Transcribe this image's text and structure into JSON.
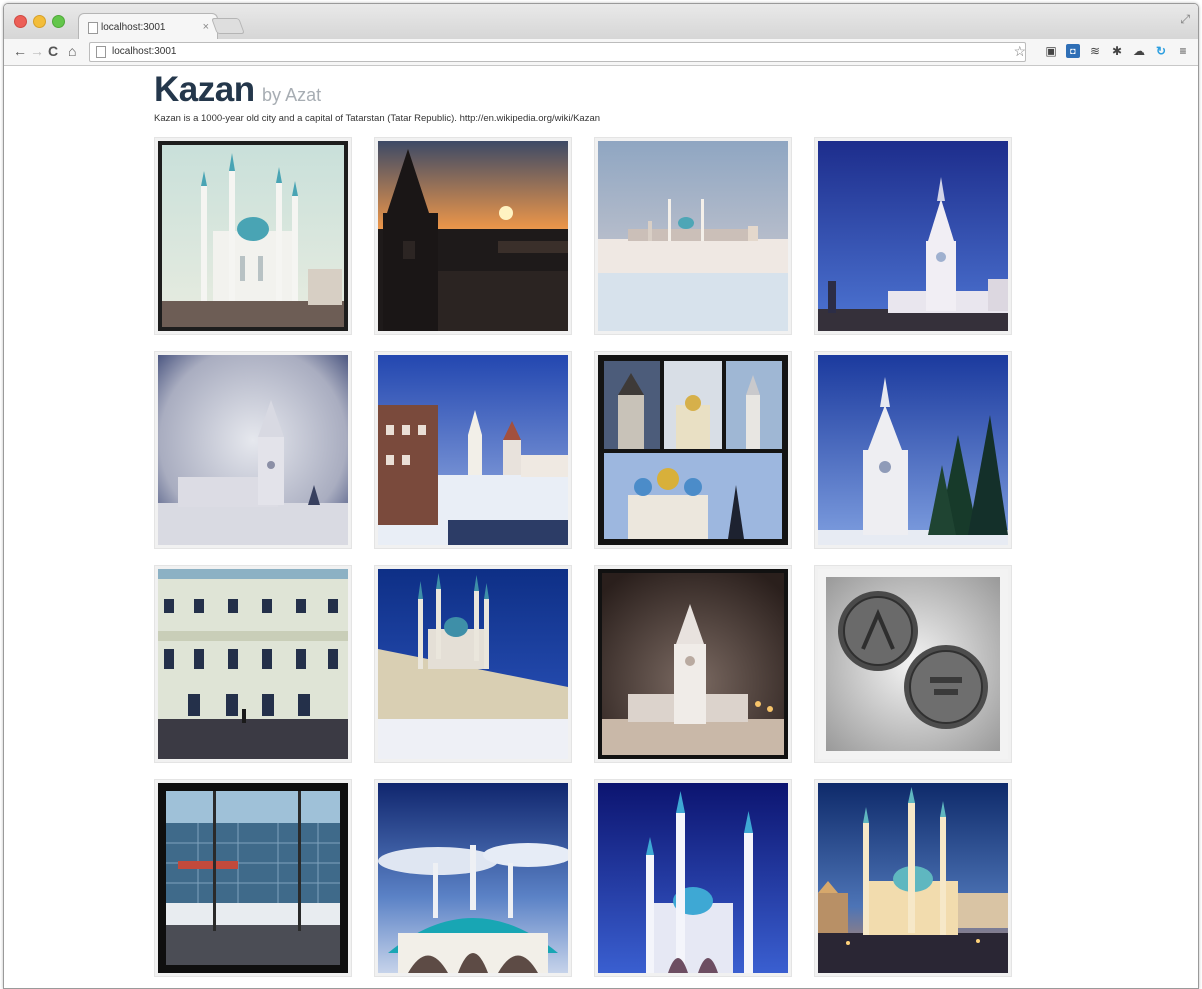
{
  "browser": {
    "tab_title": "localhost:3001",
    "tab_close": "×",
    "url": "localhost:3001",
    "nav": {
      "back": "←",
      "forward": "→",
      "reload": "C",
      "home": "⌂"
    },
    "bookmark_star": "☆",
    "menu": "≡",
    "extension_icons": [
      "reader-icon",
      "pocket-icon",
      "layers-icon",
      "gear-icon",
      "cloud-icon",
      "sync-icon"
    ]
  },
  "page": {
    "title": "Kazan",
    "subtitle": "by Azat",
    "description": "Kazan is a 1000-year old city and a capital of Tatarstan (Tatar Republic). http://en.wikipedia.org/wiki/Kazan"
  },
  "gallery": {
    "photos": [
      {
        "subject": "Kul Sharif mosque, pale sky"
      },
      {
        "subject": "Kremlin tower at sunset"
      },
      {
        "subject": "Kremlin across frozen river"
      },
      {
        "subject": "Spasskaya tower, deep blue sky"
      },
      {
        "subject": "Spasskaya tower in winter haze"
      },
      {
        "subject": "Kremlin buildings, blue sky"
      },
      {
        "subject": "Collage of Kremlin churches"
      },
      {
        "subject": "Spasskaya tower with fir trees"
      },
      {
        "subject": "University facade"
      },
      {
        "subject": "Kul Sharif behind Kremlin wall"
      },
      {
        "subject": "Spasskaya tower at night"
      },
      {
        "subject": "Two coins in a hand"
      },
      {
        "subject": "Glass building, snowy street"
      },
      {
        "subject": "Mosque with teal dome"
      },
      {
        "subject": "Kul Sharif mosque at night"
      },
      {
        "subject": "Kul Sharif mosque at dusk"
      }
    ]
  }
}
